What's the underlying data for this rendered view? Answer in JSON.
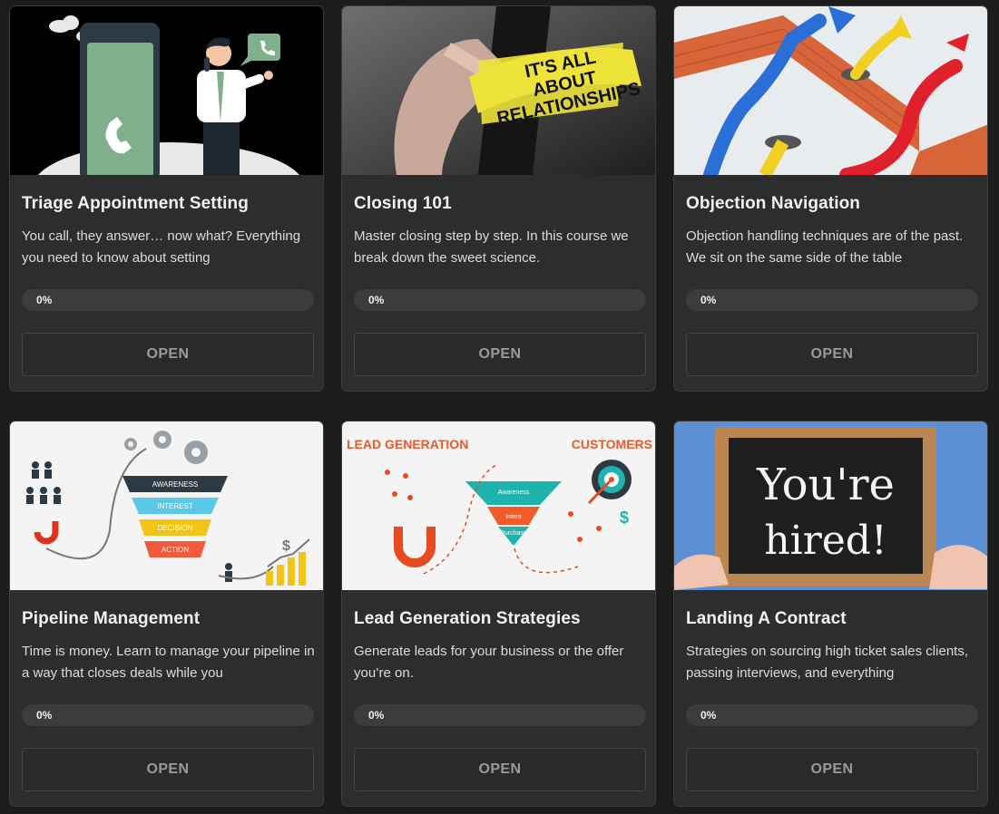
{
  "courses": [
    {
      "title": "Triage Appointment Setting",
      "description": "You call, they answer… now what? Everything you need to know about setting",
      "progress_label": "0%",
      "progress": 0,
      "button_label": "OPEN"
    },
    {
      "title": "Closing 101",
      "description": "Master closing step by step. In this course we break down the sweet science.",
      "progress_label": "0%",
      "progress": 0,
      "button_label": "OPEN",
      "image_text": [
        "IT'S ALL",
        "ABOUT",
        "RELATIONSHIPS"
      ]
    },
    {
      "title": "Objection Navigation",
      "description": "Objection handling techniques are of the past. We sit on the same side of the table",
      "progress_label": "0%",
      "progress": 0,
      "button_label": "OPEN"
    },
    {
      "title": "Pipeline Management",
      "description": "Time is money. Learn to manage your pipeline in a way that closes deals while you",
      "progress_label": "0%",
      "progress": 0,
      "button_label": "OPEN",
      "image_text": [
        "AWARENESS",
        "INTEREST",
        "DECISION",
        "ACTION"
      ]
    },
    {
      "title": "Lead Generation Strategies",
      "description": "Generate leads for your business or the offer you’re on.",
      "progress_label": "0%",
      "progress": 0,
      "button_label": "OPEN",
      "image_text": [
        "LEAD GENERATION",
        "CUSTOMERS",
        "Awareness",
        "Intent",
        "Purchase"
      ]
    },
    {
      "title": "Landing A Contract",
      "description": "Strategies on sourcing high ticket sales clients, passing interviews, and everything",
      "progress_label": "0%",
      "progress": 0,
      "button_label": "OPEN",
      "image_text": [
        "You're",
        "hired!"
      ]
    }
  ],
  "colors": {
    "page_bg": "#1c1c1c",
    "card_bg": "#2d2d2d",
    "progress_track": "#3c3c3c",
    "button_text": "#9a9a9a"
  }
}
